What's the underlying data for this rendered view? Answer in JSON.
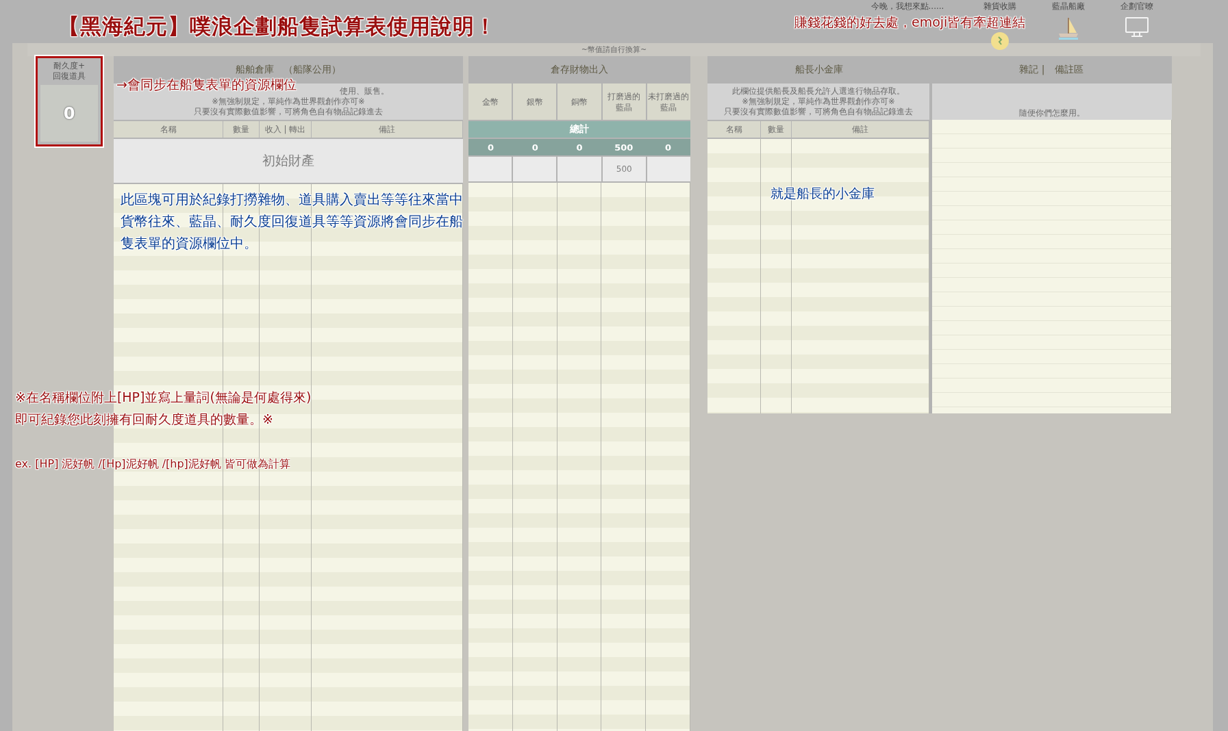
{
  "title": "【黑海紀元】噗浪企劃船隻試算表使用說明！",
  "header_links": [
    {
      "label": "今晚，我想來點......"
    },
    {
      "label": "雜貨收購"
    },
    {
      "label": "藍晶船廠"
    },
    {
      "label": "企劃官暸"
    }
  ],
  "links_note": "賺錢花錢的好去處，emoji皆有牽超連結",
  "exchange_note": "~幣值請自行換算~",
  "durability": {
    "label_lines": [
      "耐久度+",
      "回復道具"
    ],
    "value": "0"
  },
  "warehouse": {
    "title": "船舶倉庫　（船隊公用）",
    "description": [
      "使用、販售。",
      "※無強制規定，單純作為世界觀創作亦可※",
      "只要沒有實際數值影響，可將角色自有物品記錄進去"
    ],
    "columns": [
      "名稱",
      "數量",
      "收入 | 轉出",
      "備註"
    ],
    "initial_row": "初始財產",
    "annotation": "→會同步在船隻表單的資源欄位",
    "note": "此區塊可用於紀錄打撈雜物、道具購入賣出等等往來當中貨幣往來、藍晶、耐久度回復道具等等資源將會同步在船隻表單的資源欄位中。"
  },
  "ledger": {
    "title": "倉存財物出入",
    "columns": [
      "金幣",
      "銀幣",
      "銅幣",
      "打磨過的藍晶",
      "未打磨過的藍晶"
    ],
    "total_label": "總計",
    "totals": [
      "0",
      "0",
      "0",
      "500",
      "0"
    ],
    "initial_row": {
      "column_4": "500"
    }
  },
  "captain_vault": {
    "title": "船長小金庫",
    "description": [
      "此欄位提供船長及船長允許人選進行物品存取。",
      "※無強制規定，單純作為世界觀創作亦可※",
      "只要沒有實際數值影響，可將角色自有物品記錄進去"
    ],
    "columns": [
      "名稱",
      "數量",
      "備註"
    ],
    "annotation": "就是船長的小金庫"
  },
  "notes_area": {
    "title": "雜記 |　備註區",
    "description": "隨便你們怎麼用。"
  },
  "hp_note": {
    "lines": [
      "※在名稱欄位附上[HP]並寫上量詞(無論是何處得來)",
      "即可紀錄您此刻擁有回耐久度道具的數量。※"
    ],
    "example": "ex. [HP] 泥好帆 /[Hp]泥好帆 /[hp]泥好帆 皆可做為計算"
  }
}
